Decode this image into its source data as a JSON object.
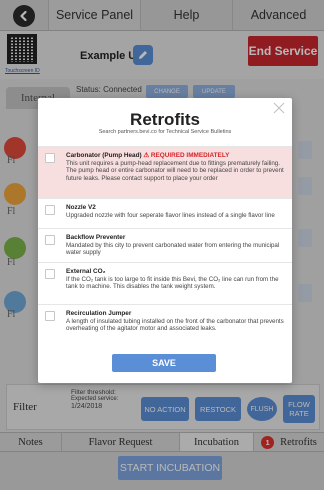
{
  "topnav": {
    "back_icon": "arrow-left-icon",
    "tabs": [
      {
        "label": "Service Panel",
        "active": true
      },
      {
        "label": "Help",
        "active": false
      },
      {
        "label": "Advanced",
        "active": false
      }
    ]
  },
  "unit": {
    "qr_link": "Touchscreen ID",
    "name": "Example Unit",
    "edit_icon": "pencil-icon",
    "end_service_label": "End Service"
  },
  "status": {
    "internal_tab": "Internal",
    "text": "Status: Connected",
    "change_label": "CHANGE",
    "update_label": "UPDATE"
  },
  "flavor_labels": [
    "Fl",
    "Fl",
    "Fl",
    "Fl"
  ],
  "filter": {
    "label": "Filter",
    "threshold_label": "Filter threshold:",
    "expected_service_label": "Expected service:",
    "date": "1/24/2018",
    "no_action": "NO ACTION",
    "restock": "RESTOCK",
    "flush": "FLUSH",
    "flow_rate": "FLOW RATE"
  },
  "bottom_tabs": {
    "notes": "Notes",
    "flavor_request": "Flavor Request",
    "incubation": "Incubation",
    "retrofits": "Retrofits",
    "retrofits_badge": "1"
  },
  "start_incubation": "START INCUBATION",
  "modal": {
    "title": "Retrofits",
    "subtitle": "Search partners.bevi.co for Technical Service Bulletins",
    "close_icon": "close-icon",
    "items": [
      {
        "title": "Carbonator (Pump Head)",
        "required": "⚠ REQUIRED IMMEDIATELY",
        "desc": "This unit requires a pump-head replacement due to fittings prematurely failing. The pump head or entire carbonator will need to be replaced in order to prevent future leaks. Please contact support to place your order",
        "alert": true
      },
      {
        "title": "Nozzle V2",
        "required": "",
        "desc": "Upgraded nozzle with four seperate flavor lines instead of a single flavor line",
        "alert": false
      },
      {
        "title": "Backflow Preventer",
        "required": "",
        "desc": "Mandated by this city to prevent carbonated water from entering the municipal water supply",
        "alert": false
      },
      {
        "title": "External CO₂",
        "required": "",
        "desc": "If the CO₂ tank is too large to fit inside this Bevi, the CO₂ line can run from the tank to machine. This disables the tank weight system.",
        "alert": false
      },
      {
        "title": "Recirculation Jumper",
        "required": "",
        "desc": "A length of insulated tubing installed on the front of the carbonator that prevents overheating of the agitator motor and associated leaks.",
        "alert": false
      }
    ],
    "save_label": "SAVE"
  },
  "colors": {
    "accent_blue": "#5a8ed6",
    "end_service_red": "#c8262f",
    "alert_bg": "#f7dfdf",
    "required_red": "#d2252b"
  }
}
